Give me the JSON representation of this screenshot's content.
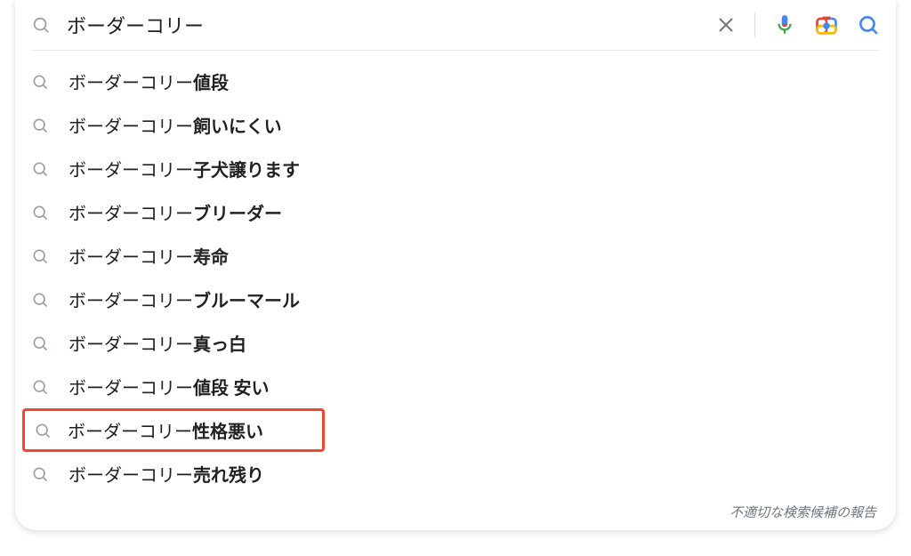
{
  "search": {
    "query": "ボーダーコリー"
  },
  "suggestions": [
    {
      "base": "ボーダーコリー ",
      "bold": "値段",
      "highlighted": false
    },
    {
      "base": "ボーダーコリー ",
      "bold": "飼いにくい",
      "highlighted": false
    },
    {
      "base": "ボーダーコリー",
      "bold": "子犬譲ります",
      "highlighted": false
    },
    {
      "base": "ボーダーコリー ",
      "bold": "ブリーダー",
      "highlighted": false
    },
    {
      "base": "ボーダーコリー ",
      "bold": "寿命",
      "highlighted": false
    },
    {
      "base": "ボーダーコリー ",
      "bold": "ブルーマール",
      "highlighted": false
    },
    {
      "base": "ボーダーコリー ",
      "bold": "真っ白",
      "highlighted": false
    },
    {
      "base": "ボーダーコリー ",
      "bold": "値段 安い",
      "highlighted": false
    },
    {
      "base": "ボーダーコリー ",
      "bold": "性格悪い",
      "highlighted": true
    },
    {
      "base": "ボーダーコリー",
      "bold": "売れ残り",
      "highlighted": false
    }
  ],
  "footer": {
    "report_label": "不適切な検索候補の報告"
  }
}
